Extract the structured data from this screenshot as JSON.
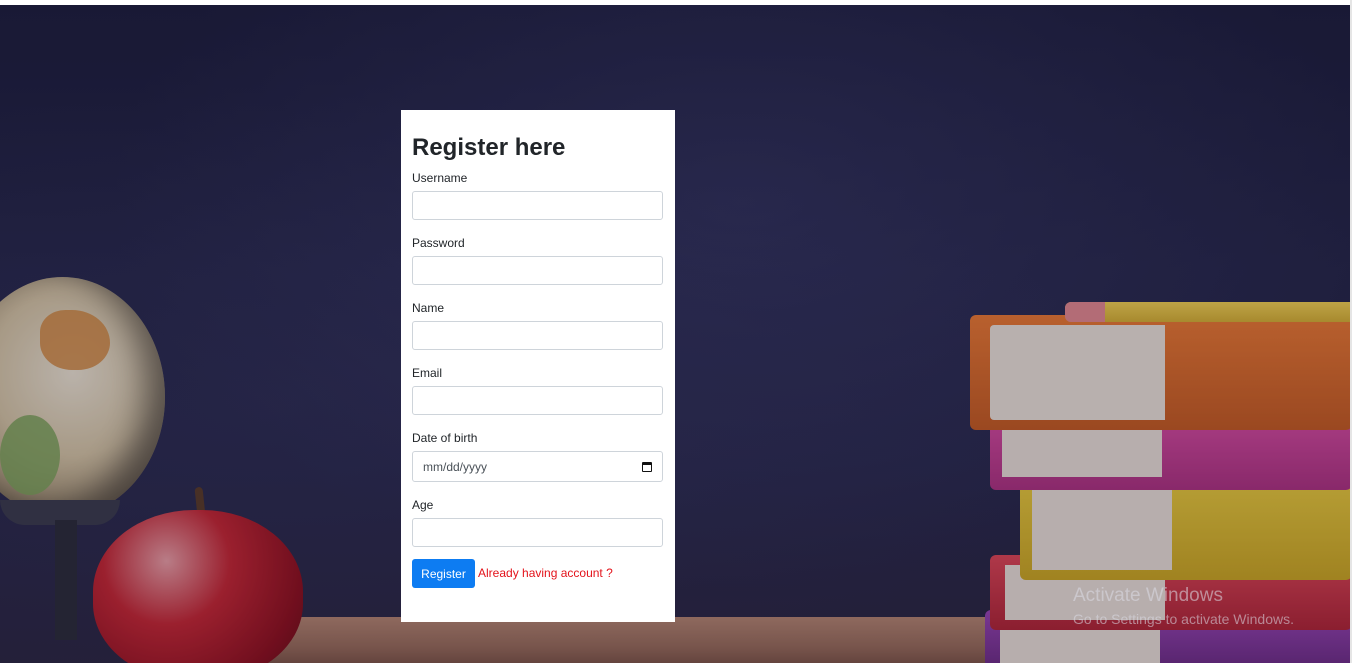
{
  "form": {
    "title": "Register here",
    "fields": [
      {
        "label": "Username",
        "value": "",
        "placeholder": ""
      },
      {
        "label": "Password",
        "value": "",
        "placeholder": ""
      },
      {
        "label": "Name",
        "value": "",
        "placeholder": ""
      },
      {
        "label": "Email",
        "value": "",
        "placeholder": ""
      },
      {
        "label": "Date of birth",
        "value": "",
        "placeholder": "mm/dd/yyyy"
      },
      {
        "label": "Age",
        "value": "",
        "placeholder": ""
      }
    ],
    "register_label": "Register",
    "login_link": "Already having account ?"
  },
  "watermark": {
    "title": "Activate Windows",
    "subtitle": "Go to Settings to activate Windows."
  },
  "colors": {
    "primary_button": "#0d7cf2",
    "link": "#e3131b",
    "card_background": "#ffffff"
  },
  "icons": {
    "date_picker": "calendar-icon"
  }
}
